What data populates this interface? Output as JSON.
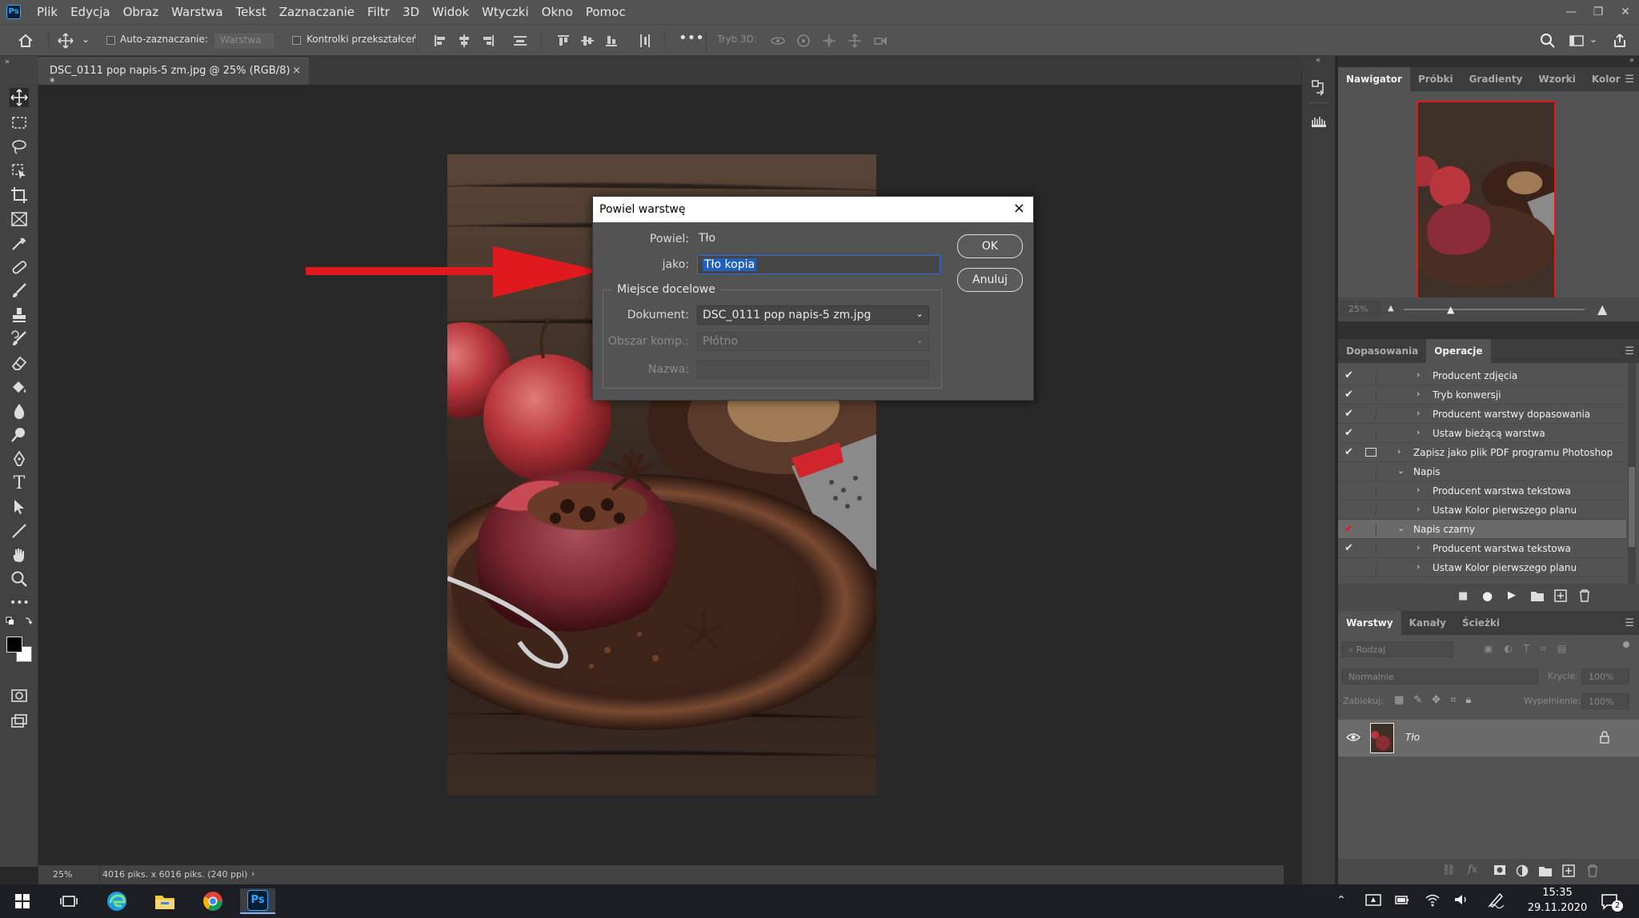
{
  "app": {
    "logo": "Ps"
  },
  "menu": [
    "Plik",
    "Edycja",
    "Obraz",
    "Warstwa",
    "Tekst",
    "Zaznaczanie",
    "Filtr",
    "3D",
    "Widok",
    "Wtyczki",
    "Okno",
    "Pomoc"
  ],
  "options": {
    "auto_select_label": "Auto-zaznaczanie:",
    "auto_select_value": "Warstwa",
    "transform_controls_label": "Kontrolki przekształceń",
    "mode3d_label": "Tryb 3D:"
  },
  "document_tab": {
    "title": "DSC_0111 pop napis-5 zm.jpg @ 25% (RGB/8) *"
  },
  "status": {
    "zoom": "25%",
    "doc_info": "4016 piks. x 6016 piks. (240 ppi)",
    "arrow": "›"
  },
  "dialog": {
    "title": "Powiel warstwę",
    "duplicate_label": "Powiel:",
    "duplicate_value": "Tło",
    "as_label": "jako:",
    "as_value": "Tło kopia",
    "destination_label": "Miejsce docelowe",
    "document_label": "Dokument:",
    "document_value": "DSC_0111 pop napis-5 zm.jpg",
    "artboard_label": "Obszar komp.:",
    "artboard_value": "Płótno",
    "name_label": "Nazwa:",
    "ok": "OK",
    "cancel": "Anuluj"
  },
  "navigator": {
    "tabs": [
      "Nawigator",
      "Próbki",
      "Gradienty",
      "Wzorki",
      "Kolor"
    ],
    "zoom": "25%"
  },
  "actions": {
    "tabs": [
      "Dopasowania",
      "Operacje"
    ],
    "rows": [
      {
        "check": "✔",
        "arrow": "›",
        "label": "Producent zdjęcia",
        "indent": 2,
        "dialog": false,
        "red": false
      },
      {
        "check": "✔",
        "arrow": "›",
        "label": "Tryb konwersji",
        "indent": 2,
        "dialog": false,
        "red": false
      },
      {
        "check": "✔",
        "arrow": "›",
        "label": "Producent warstwy dopasowania",
        "indent": 2,
        "dialog": false,
        "red": false
      },
      {
        "check": "✔",
        "arrow": "›",
        "label": "Ustaw bieżącą warstwa",
        "indent": 2,
        "dialog": false,
        "red": false
      },
      {
        "check": "✔",
        "arrow": "›",
        "label": "Zapisz jako plik PDF programu Photoshop",
        "indent": 1,
        "dialog": true,
        "red": false
      },
      {
        "check": "",
        "arrow": "⌄",
        "label": "Napis",
        "indent": 1,
        "dialog": false,
        "red": false
      },
      {
        "check": "",
        "arrow": "›",
        "label": "Producent warstwa tekstowa",
        "indent": 2,
        "dialog": false,
        "red": false
      },
      {
        "check": "",
        "arrow": "›",
        "label": "Ustaw Kolor pierwszego planu",
        "indent": 2,
        "dialog": false,
        "red": false
      },
      {
        "check": "✔",
        "arrow": "⌄",
        "label": "Napis czarny",
        "indent": 1,
        "dialog": false,
        "red": true
      },
      {
        "check": "✔",
        "arrow": "›",
        "label": "Producent warstwa tekstowa",
        "indent": 2,
        "dialog": false,
        "red": false
      },
      {
        "check": "",
        "arrow": "›",
        "label": "Ustaw Kolor pierwszego planu",
        "indent": 2,
        "dialog": false,
        "red": false
      }
    ]
  },
  "layers": {
    "tabs": [
      "Warstwy",
      "Kanały",
      "Ścieżki"
    ],
    "filter_placeholder": "Rodzaj",
    "blend_mode": "Normalnie",
    "opacity_label": "Krycie:",
    "opacity_value": "100%",
    "lock_label": "Zablokuj:",
    "fill_label": "Wypełnienie:",
    "fill_value": "100%",
    "items": [
      {
        "name": "Tło",
        "locked": true
      }
    ]
  },
  "taskbar": {
    "time": "15:35",
    "date": "29.11.2020",
    "notifications": "2"
  },
  "colors": {
    "accent_red": "#e0191f",
    "selection_blue": "#1f5fbf",
    "chrome": "#535353"
  }
}
